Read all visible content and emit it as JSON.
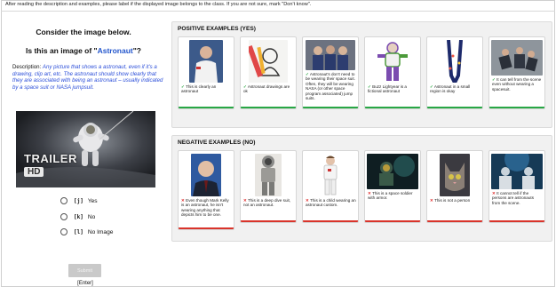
{
  "instructions": "After reading the description and examples, please label if the displayed image belongs to the class. If you are not sure, mark \"Don't know\".",
  "task": {
    "consider": "Consider the image below.",
    "question_prefix": "Is this an image of \"",
    "class_name": "Astronaut",
    "question_suffix": "\"?",
    "description_label": "Description:",
    "description_text": "Any picture that shows a astronaut, even if it's a drawing, clip art, etc. The astronaut should show clearly that they are associated with being an astronaut – usually indicated by a space suit or NASA jumpsuit.",
    "thumbnail_overlay": "TRAILER",
    "thumbnail_badge": "HD"
  },
  "options": [
    {
      "key": "[j]",
      "label": "Yes"
    },
    {
      "key": "[k]",
      "label": "No"
    },
    {
      "key": "[l]",
      "label": "No Image"
    }
  ],
  "submit_label": "Submit",
  "enter_hint": "[Enter]",
  "positive": {
    "title": "POSITIVE EXAMPLES (YES)",
    "items": [
      {
        "mark": "✓",
        "caption": "This is clearly an astronaut"
      },
      {
        "mark": "✓",
        "caption": "Astronaut drawings are ok"
      },
      {
        "mark": "✓",
        "caption": "Astronaut's don't need to be wearing their space suit. Often, they will be wearing NASA (or other space program associated) jump suits."
      },
      {
        "mark": "✓",
        "caption": "Buzz Lightyear is a fictional astronaut"
      },
      {
        "mark": "✓",
        "caption": "Astronaut in a small region is okay"
      },
      {
        "mark": "✓",
        "caption": "It can tell from the scene even without wearing a spacesuit."
      }
    ]
  },
  "negative": {
    "title": "NEGATIVE EXAMPLES (NO)",
    "items": [
      {
        "mark": "✕",
        "caption": "Even though Mark Kelly is an astronaut, he isn't wearing anything that depicts him to be one."
      },
      {
        "mark": "✕",
        "caption": "This is a deep dive suit, not an astronaut."
      },
      {
        "mark": "✕",
        "caption": "This is a child wearing an astronaut custom."
      },
      {
        "mark": "✕",
        "caption": "This is a space soldier with armor."
      },
      {
        "mark": "✕",
        "caption": "This is not a person"
      },
      {
        "mark": "✕",
        "caption": "It cannot tell if the persons are astronauts from the scene."
      }
    ]
  },
  "colors": {
    "accent_blue": "#2c4fd9",
    "positive": "#28a745",
    "negative": "#d9342b"
  }
}
